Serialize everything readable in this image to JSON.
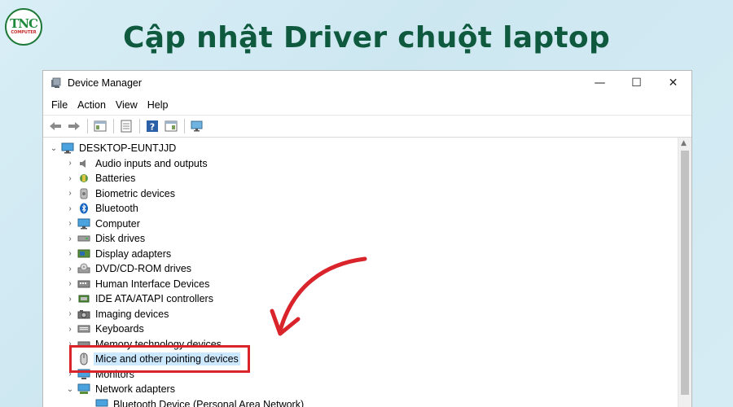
{
  "banner": {
    "title": "Cập nhật Driver chuột laptop",
    "logo_text": "TNC",
    "logo_sub": "COMPUTER"
  },
  "window": {
    "title": "Device Manager",
    "controls": [
      "—",
      "☐",
      "✕"
    ]
  },
  "menu": [
    "File",
    "Action",
    "View",
    "Help"
  ],
  "toolbar_icons": [
    "back-arrow-icon",
    "forward-arrow-icon",
    "properties-icon",
    "list-icon",
    "help-icon",
    "update-driver-icon",
    "monitor-scan-icon"
  ],
  "tree": {
    "root": "DESKTOP-EUNTJJD",
    "items": [
      {
        "label": "Audio inputs and outputs",
        "icon": "speaker-icon"
      },
      {
        "label": "Batteries",
        "icon": "battery-icon"
      },
      {
        "label": "Biometric devices",
        "icon": "biometric-icon"
      },
      {
        "label": "Bluetooth",
        "icon": "bluetooth-icon"
      },
      {
        "label": "Computer",
        "icon": "computer-icon"
      },
      {
        "label": "Disk drives",
        "icon": "disk-drive-icon"
      },
      {
        "label": "Display adapters",
        "icon": "display-adapter-icon"
      },
      {
        "label": "DVD/CD-ROM drives",
        "icon": "dvd-drive-icon"
      },
      {
        "label": "Human Interface Devices",
        "icon": "hid-icon"
      },
      {
        "label": "IDE ATA/ATAPI controllers",
        "icon": "ide-controller-icon"
      },
      {
        "label": "Imaging devices",
        "icon": "camera-icon"
      },
      {
        "label": "Keyboards",
        "icon": "keyboard-icon"
      },
      {
        "label": "Memory technology devices",
        "icon": "memory-icon"
      },
      {
        "label": "Mice and other pointing devices",
        "icon": "mouse-icon",
        "selected": true
      },
      {
        "label": "Monitors",
        "icon": "monitor-icon"
      },
      {
        "label": "Network adapters",
        "icon": "network-adapter-icon",
        "expanded": true
      },
      {
        "label": "Bluetooth Device (Personal Area Network)",
        "icon": "network-adapter-icon",
        "child": true
      }
    ]
  },
  "colors": {
    "title": "#0f5a3f",
    "highlight": "#d9242b",
    "selection": "#cce8ff"
  }
}
